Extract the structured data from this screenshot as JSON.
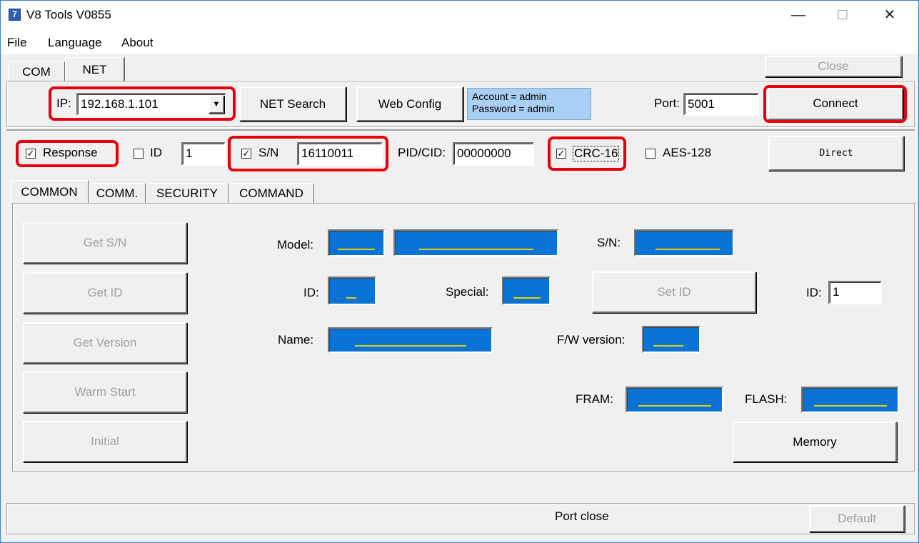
{
  "window": {
    "title": "V8 Tools V0855",
    "minimize": "—",
    "maximize": "☐",
    "close": "✕"
  },
  "menu": [
    "File",
    "Language",
    "About"
  ],
  "conn_tabs": [
    "COM",
    "NET"
  ],
  "toolbar": {
    "close_label": "Close",
    "ip_label": "IP:",
    "ip_value": "192.168.1.101",
    "net_search_label": "NET Search",
    "web_config_label": "Web Config",
    "account_text": "Account = admin",
    "password_text": "Password = admin",
    "port_label": "Port:",
    "port_value": "5001",
    "connect_label": "Connect"
  },
  "options": {
    "response_label": "Response",
    "response_checked": true,
    "id_label": "ID",
    "id_checked": false,
    "id_value": "1",
    "sn_label": "S/N",
    "sn_checked": true,
    "sn_value": "16110011",
    "pidcid_label": "PID/CID:",
    "pidcid_value": "00000000",
    "crc_label": "CRC-16",
    "crc_checked": true,
    "aes_label": "AES-128",
    "aes_checked": false,
    "direct_label": "Direct"
  },
  "func_tabs": [
    "COMMON",
    "COMM.",
    "SECURITY",
    "COMMAND"
  ],
  "common": {
    "get_sn_label": "Get S/N",
    "get_id_label": "Get ID",
    "get_version_label": "Get Version",
    "warm_start_label": "Warm Start",
    "initial_label": "Initial",
    "model_label": "Model:",
    "sn_label": "S/N:",
    "id_label": "ID:",
    "special_label": "Special:",
    "set_id_label": "Set ID",
    "id2_label": "ID:",
    "id2_value": "1",
    "name_label": "Name:",
    "fw_label": "F/W version:",
    "fram_label": "FRAM:",
    "flash_label": "FLASH:",
    "memory_label": "Memory"
  },
  "status": {
    "text": "Port close",
    "default_label": "Default"
  },
  "colors": {
    "highlight": "#e50010",
    "value_field": "#0a74d6",
    "value_line": "#e6d200",
    "info_box": "#a9cff2"
  }
}
